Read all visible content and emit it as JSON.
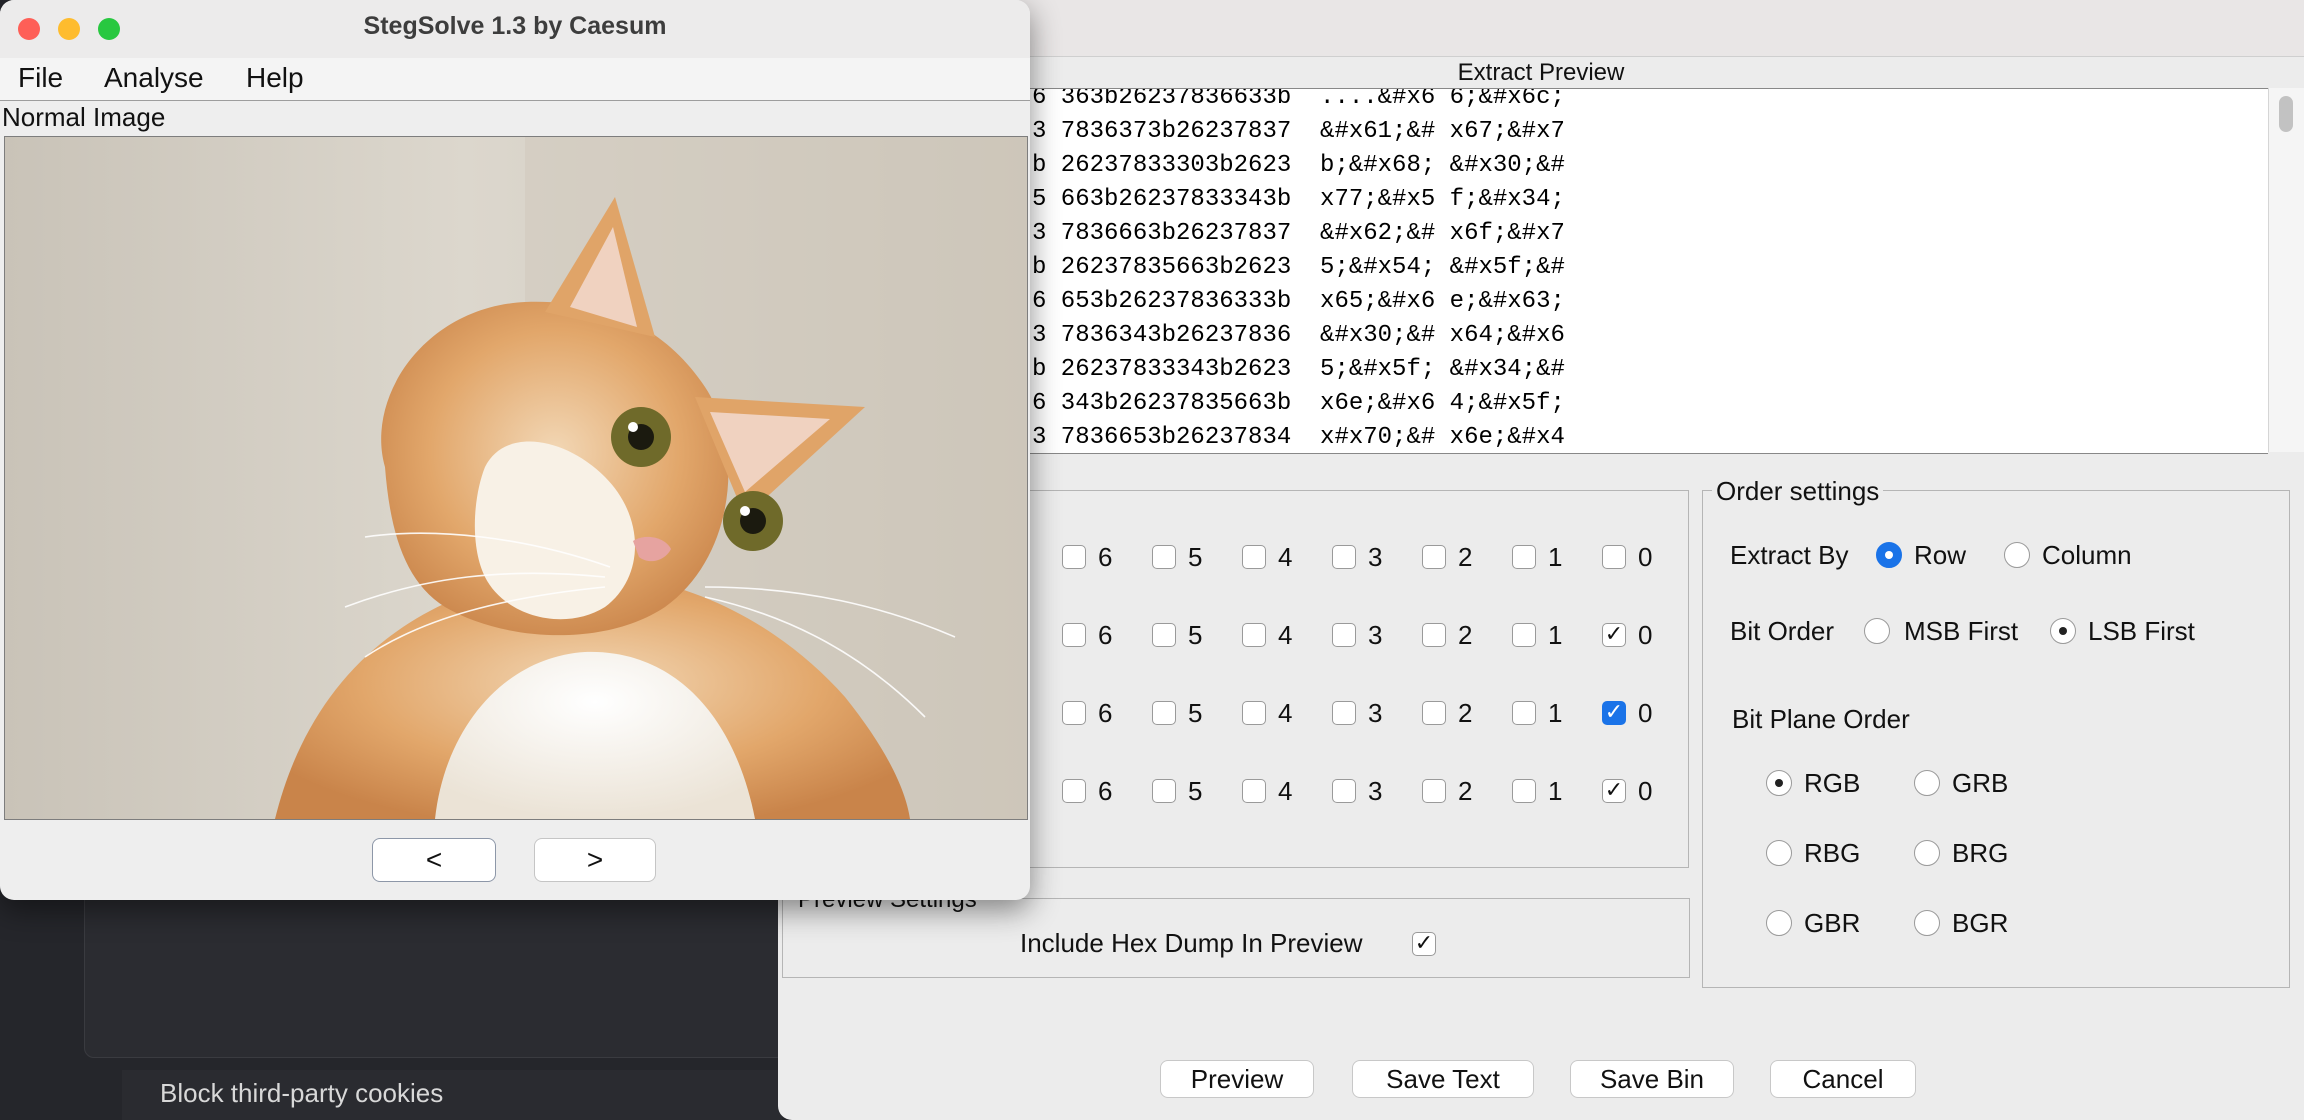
{
  "background": {
    "cookies_text": "Block third-party cookies"
  },
  "stegsolve": {
    "title": "StegSolve 1.3 by Caesum",
    "menu": [
      "File",
      "Analyse",
      "Help"
    ],
    "image_label": "Normal Image",
    "prev_button": "<",
    "next_button": ">"
  },
  "extract": {
    "header": "Extract Preview",
    "hex_lines": [
      "6 363b26237836633b  ....&#x6 6;&#x6c;",
      "3 7836373b26237837  &#x61;&# x67;&#x7",
      "b 26237833303b2623  b;&#x68; &#x30;&#",
      "5 663b26237833343b  x77;&#x5 f;&#x34;",
      "3 7836663b26237837  &#x62;&# x6f;&#x7",
      "b 26237835663b2623  5;&#x54; &#x5f;&#",
      "6 653b26237836333b  x65;&#x6 e;&#x63;",
      "3 7836343b26237836  &#x30;&# x64;&#x6",
      "b 26237833343b2623  5;&#x5f; &#x34;&#",
      "6 343b26237835663b  x6e;&#x6 4;&#x5f;",
      "3 7836653b26237834  x#x70;&# x6e;&#x4"
    ],
    "bit_planes": {
      "bits": [
        "6",
        "5",
        "4",
        "3",
        "2",
        "1",
        "0"
      ],
      "rows": [
        {
          "checked": [
            false,
            false,
            false,
            false,
            false,
            false,
            false
          ],
          "zero_style": "plain"
        },
        {
          "checked": [
            false,
            false,
            false,
            false,
            false,
            false,
            true
          ],
          "zero_style": "plain"
        },
        {
          "checked": [
            false,
            false,
            false,
            false,
            false,
            false,
            true
          ],
          "zero_style": "blue"
        },
        {
          "checked": [
            false,
            false,
            false,
            false,
            false,
            false,
            true
          ],
          "zero_style": "plain"
        }
      ]
    },
    "preview_settings": {
      "legend": "Preview Settings",
      "hex_dump_label": "Include Hex Dump In Preview",
      "hex_dump_checked": true
    },
    "order_settings": {
      "legend": "Order settings",
      "extract_by_label": "Extract By",
      "extract_by_options": [
        "Row",
        "Column"
      ],
      "extract_by_selected": "Row",
      "bit_order_label": "Bit Order",
      "bit_order_options": [
        "MSB First",
        "LSB First"
      ],
      "bit_order_selected": "LSB First",
      "bit_plane_order_label": "Bit Plane Order",
      "bit_plane_order_options": [
        "RGB",
        "GRB",
        "RBG",
        "BRG",
        "GBR",
        "BGR"
      ],
      "bit_plane_order_selected": "RGB"
    },
    "buttons": {
      "preview": "Preview",
      "save_text": "Save Text",
      "save_bin": "Save Bin",
      "cancel": "Cancel"
    }
  }
}
